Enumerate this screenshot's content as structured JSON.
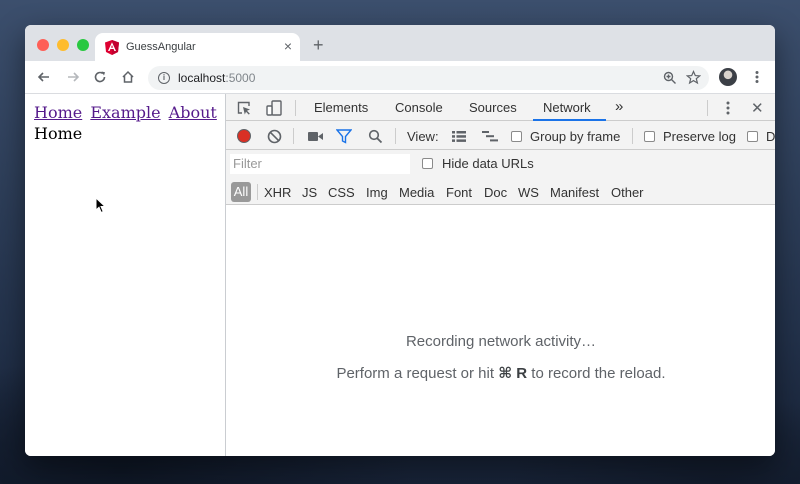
{
  "tab": {
    "title": "GuessAngular",
    "close": "×"
  },
  "toolbar": {
    "url_host": "localhost",
    "url_port": ":5000",
    "new_tab": "+"
  },
  "page": {
    "nav": [
      "Home",
      "Example",
      "About"
    ],
    "route_text": "Home"
  },
  "devtools": {
    "tabs": [
      "Elements",
      "Console",
      "Sources",
      "Network"
    ],
    "active_tab": "Network",
    "more": "»",
    "close": "✕",
    "network": {
      "view_label": "View:",
      "group_by_frame": "Group by frame",
      "preserve_log": "Preserve log",
      "truncated_option": "D",
      "filter_placeholder": "Filter",
      "hide_data_urls": "Hide data URLs",
      "types": [
        "All",
        "XHR",
        "JS",
        "CSS",
        "Img",
        "Media",
        "Font",
        "Doc",
        "WS",
        "Manifest",
        "Other"
      ],
      "empty_line1": "Recording network activity…",
      "empty_line2_before": "Perform a request or hit ",
      "empty_line2_key": "⌘ R",
      "empty_line2_after": " to record the reload."
    }
  },
  "colors": {
    "traffic_red": "#fe5f57",
    "traffic_yellow": "#febc2e",
    "traffic_green": "#28c840",
    "record_red": "#d93025",
    "accent_blue": "#1a73e8",
    "link_visited": "#551a8b",
    "angular_red": "#dd0031"
  }
}
